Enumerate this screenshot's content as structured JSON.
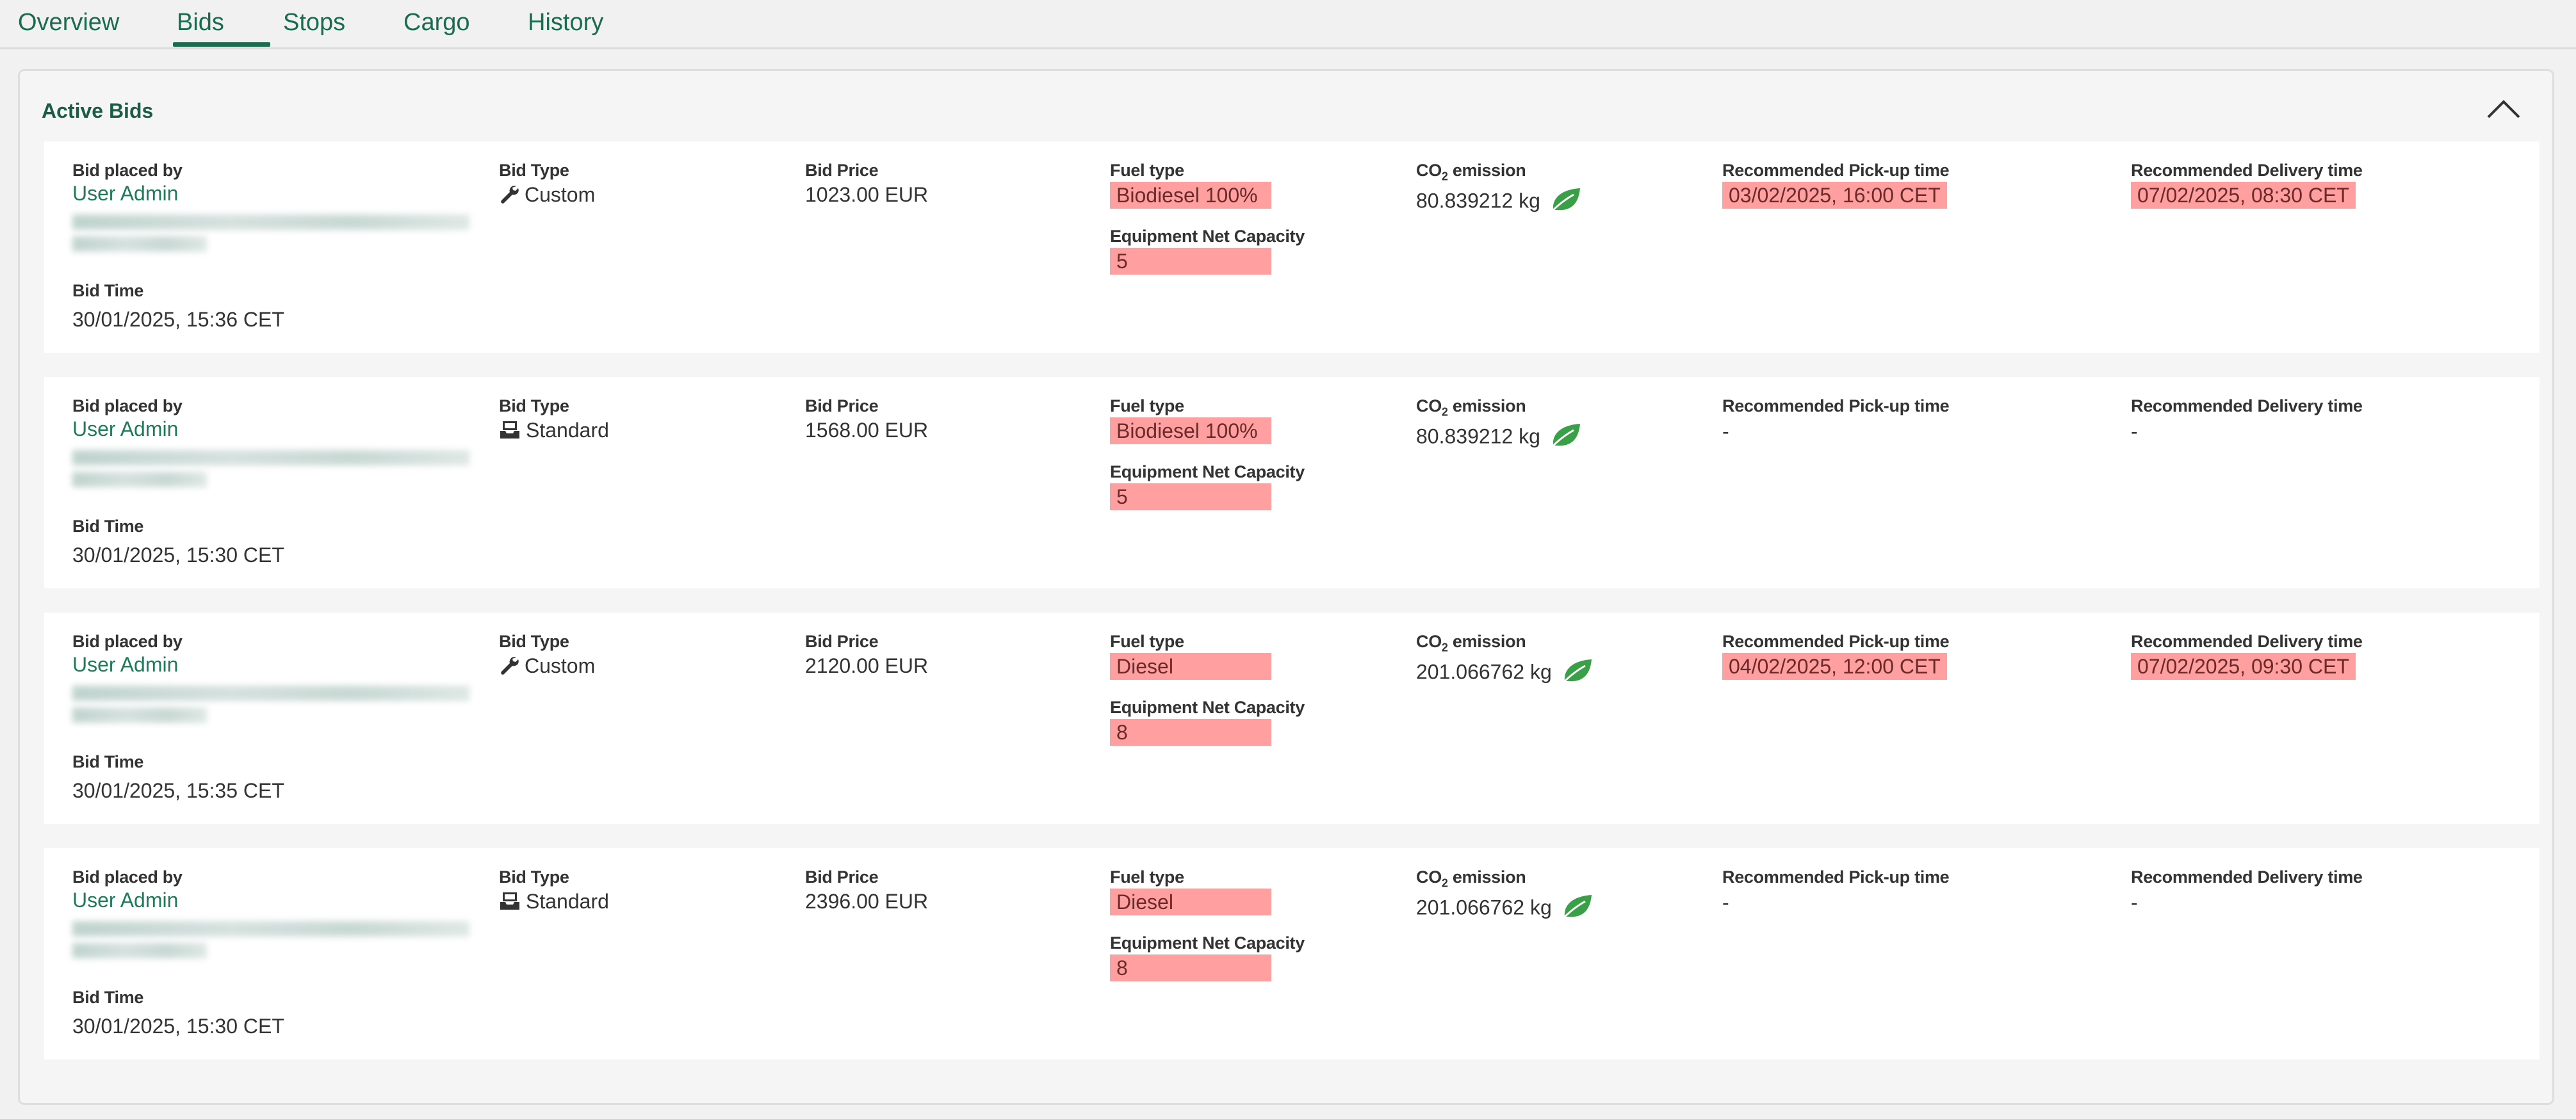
{
  "tabs": [
    {
      "label": "Overview",
      "active": false
    },
    {
      "label": "Bids",
      "active": true
    },
    {
      "label": "Stops",
      "active": false
    },
    {
      "label": "Cargo",
      "active": false
    },
    {
      "label": "History",
      "active": false
    }
  ],
  "panel": {
    "title": "Active Bids",
    "collapse_icon": "chevron-up-icon"
  },
  "labels": {
    "bid_placed_by": "Bid placed by",
    "bid_time": "Bid Time",
    "bid_type": "Bid Type",
    "bid_price": "Bid Price",
    "fuel_type": "Fuel type",
    "equipment_net_capacity": "Equipment Net Capacity",
    "co2_prefix": "CO",
    "co2_sub": "2",
    "co2_suffix": " emission",
    "pickup": "Recommended Pick-up time",
    "delivery": "Recommended Delivery time"
  },
  "colors": {
    "accent": "#1a6b50",
    "highlight": "#ff9f9f",
    "leaf": "#3aa047"
  },
  "bids": [
    {
      "user": "User Admin",
      "bid_time": "30/01/2025, 15:36 CET",
      "bid_type": "Custom",
      "bid_type_icon": "wrench-icon",
      "price": "1023.00 EUR",
      "fuel": "Biodiesel 100%",
      "capacity": "5",
      "co2": "80.839212 kg",
      "pickup": "03/02/2025, 16:00 CET",
      "delivery": "07/02/2025, 08:30 CET"
    },
    {
      "user": "User Admin",
      "bid_time": "30/01/2025, 15:30 CET",
      "bid_type": "Standard",
      "bid_type_icon": "inbox-icon",
      "price": "1568.00 EUR",
      "fuel": "Biodiesel 100%",
      "capacity": "5",
      "co2": "80.839212 kg",
      "pickup": "-",
      "delivery": "-"
    },
    {
      "user": "User Admin",
      "bid_time": "30/01/2025, 15:35 CET",
      "bid_type": "Custom",
      "bid_type_icon": "wrench-icon",
      "price": "2120.00 EUR",
      "fuel": "Diesel",
      "capacity": "8",
      "co2": "201.066762 kg",
      "pickup": "04/02/2025, 12:00 CET",
      "delivery": "07/02/2025, 09:30 CET"
    },
    {
      "user": "User Admin",
      "bid_time": "30/01/2025, 15:30 CET",
      "bid_type": "Standard",
      "bid_type_icon": "inbox-icon",
      "price": "2396.00 EUR",
      "fuel": "Diesel",
      "capacity": "8",
      "co2": "201.066762 kg",
      "pickup": "-",
      "delivery": "-"
    }
  ]
}
